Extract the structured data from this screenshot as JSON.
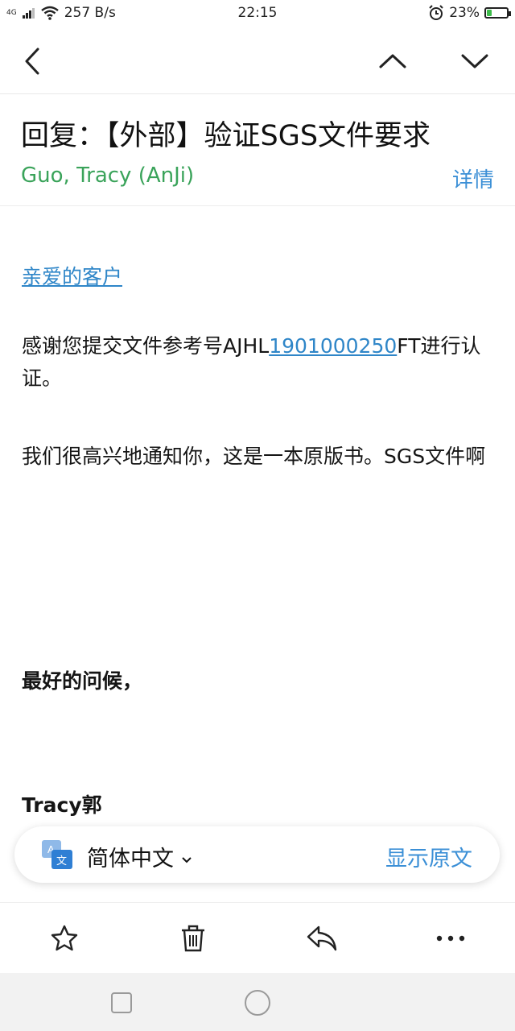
{
  "status_bar": {
    "network": "4G",
    "speed": "257 B/s",
    "time": "22:15",
    "battery": "23%",
    "battery_level": 0.23,
    "battery_color": "#3dbb4a"
  },
  "nav": {
    "back_icon": "chevron-left-icon",
    "prev_icon": "chevron-up-icon",
    "next_icon": "chevron-down-icon"
  },
  "email": {
    "subject": "回复：【外部】验证SGS文件要求",
    "sender": "Guo, Tracy (AnJi)",
    "details_label": "详情",
    "greeting": "亲爱的客户",
    "para1_prefix": "感谢您提交文件参考号AJHL",
    "para1_link": "1901000250",
    "para1_suffix": "FT进行认证。",
    "para2": "我们很高兴地通知你，这是一本原版书。SGS文件啊",
    "closing": "最好的问候，",
    "signature": "Tracy郭"
  },
  "translation": {
    "language": "简体中文",
    "show_original": "显示原文",
    "icon": "translate-icon"
  },
  "toolbar": {
    "star_icon": "star-icon",
    "delete_icon": "trash-icon",
    "reply_icon": "reply-icon",
    "more_icon": "more-icon"
  },
  "colors": {
    "sender": "#3aa35a",
    "accent": "#3b8fd6",
    "link": "#2f86c8"
  }
}
